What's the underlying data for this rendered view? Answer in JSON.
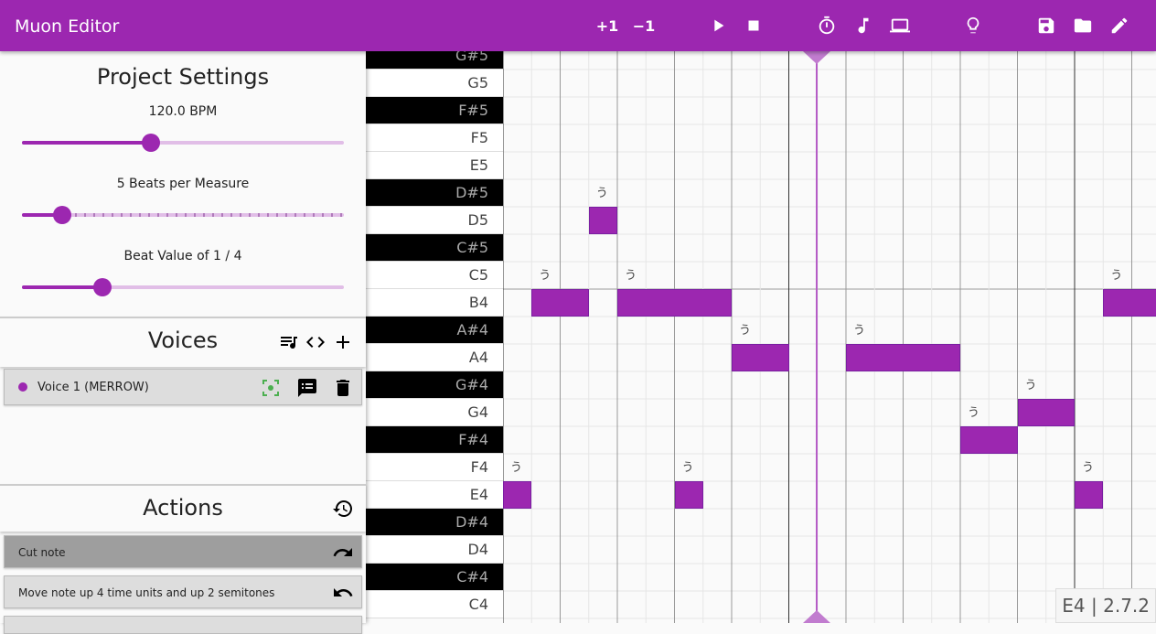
{
  "app": {
    "title": "Muon Editor",
    "accent": "#9c27b0"
  },
  "toolbar": {
    "plus_one": "+1",
    "minus_one": "−1",
    "icons": [
      "play-icon",
      "stop-icon",
      "timer-icon",
      "music-note-icon",
      "laptop-icon",
      "lightbulb-icon",
      "save-icon",
      "folder-icon",
      "pencil-icon"
    ]
  },
  "project": {
    "title": "Project Settings",
    "bpm_label": "120.0 BPM",
    "bpm_fraction": 0.4,
    "beats_label": "5 Beats per Measure",
    "beats_fraction": 0.125,
    "beat_value_label": "Beat Value of 1 / 4",
    "beat_value_fraction": 0.25
  },
  "voices": {
    "title": "Voices",
    "items": [
      {
        "name": "Voice 1 (MERROW)",
        "color": "#9c27b0"
      }
    ]
  },
  "actions": {
    "title": "Actions",
    "items": [
      {
        "label": "Cut note",
        "icon": "redo-icon"
      },
      {
        "label": "Move note up 4 time units and up 2 semitones",
        "icon": "undo-icon"
      }
    ]
  },
  "keys": [
    "G#5",
    "G5",
    "F#5",
    "F5",
    "E5",
    "D#5",
    "D5",
    "C#5",
    "C5",
    "B4",
    "A#4",
    "A4",
    "G#4",
    "G4",
    "F#4",
    "F4",
    "E4",
    "D#4",
    "D4",
    "C#4",
    "C4"
  ],
  "notes": [
    {
      "pitch": "E4",
      "start": 0,
      "length": 1,
      "lyric": "う"
    },
    {
      "pitch": "B4",
      "start": 1,
      "length": 2,
      "lyric": "う"
    },
    {
      "pitch": "D5",
      "start": 3,
      "length": 1,
      "lyric": "う"
    },
    {
      "pitch": "B4",
      "start": 4,
      "length": 4,
      "lyric": "う"
    },
    {
      "pitch": "E4",
      "start": 6,
      "length": 1,
      "lyric": "う"
    },
    {
      "pitch": "A4",
      "start": 8,
      "length": 2,
      "lyric": "う"
    },
    {
      "pitch": "A4",
      "start": 12,
      "length": 4,
      "lyric": "う"
    },
    {
      "pitch": "F#4",
      "start": 16,
      "length": 2,
      "lyric": "う"
    },
    {
      "pitch": "G4",
      "start": 18,
      "length": 2,
      "lyric": "う"
    },
    {
      "pitch": "E4",
      "start": 20,
      "length": 1,
      "lyric": "う"
    },
    {
      "pitch": "B4",
      "start": 21,
      "length": 2,
      "lyric": "う"
    }
  ],
  "status": "E4 | 2.7.2"
}
